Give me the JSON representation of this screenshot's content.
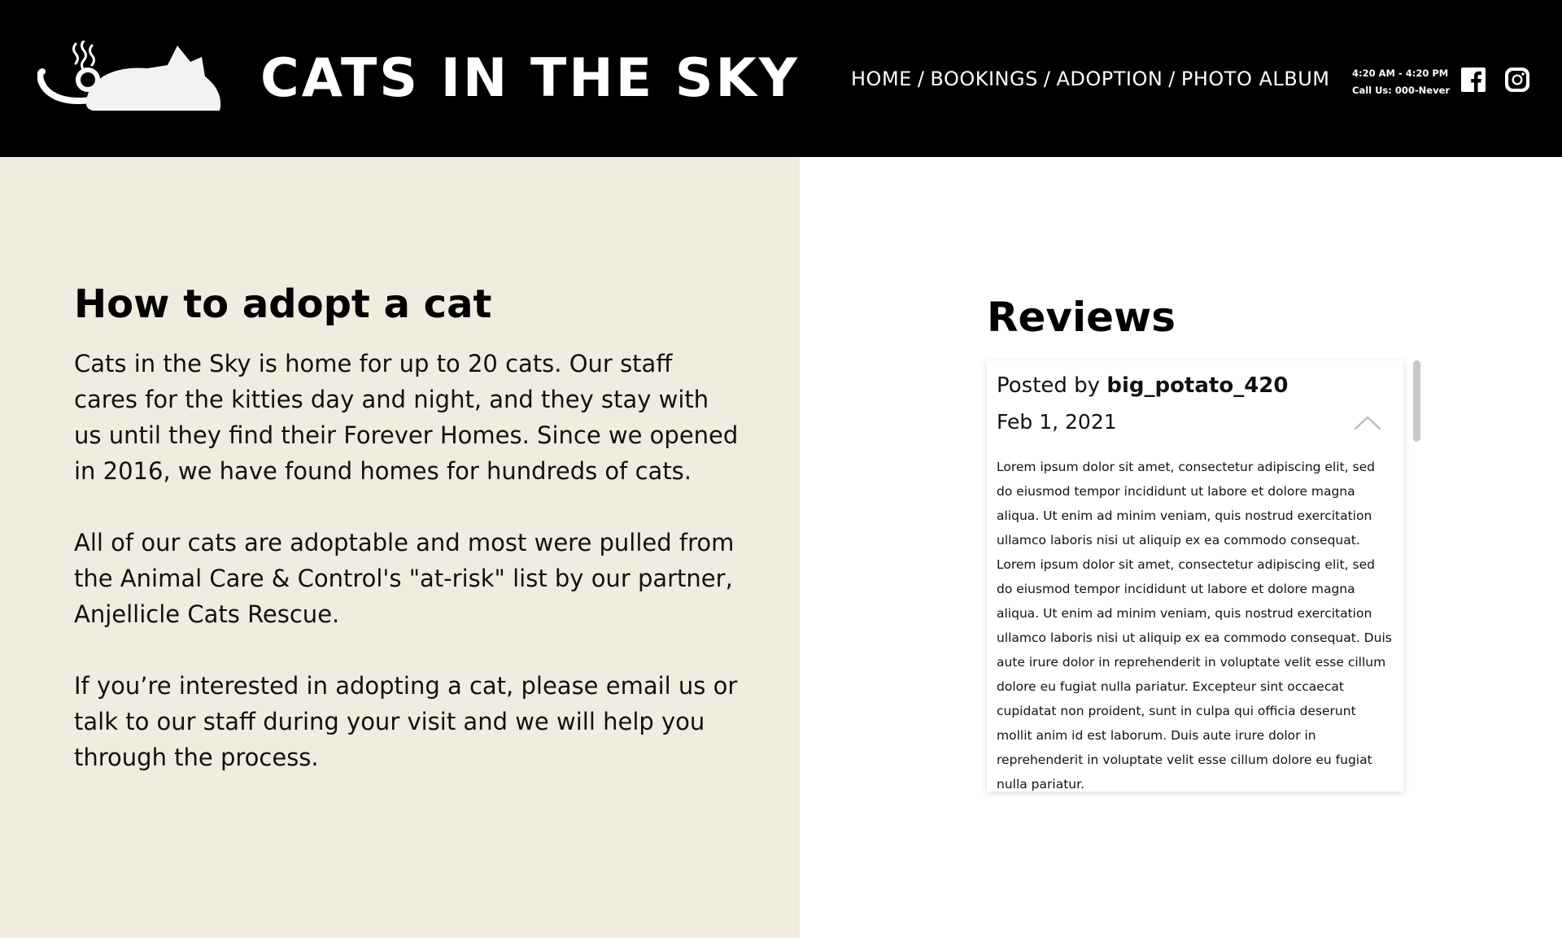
{
  "header": {
    "site_title": "CATS IN THE SKY",
    "nav": [
      {
        "label": "HOME"
      },
      {
        "label": "BOOKINGS"
      },
      {
        "label": "ADOPTION"
      },
      {
        "label": "PHOTO ALBUM"
      }
    ],
    "nav_separator": "/",
    "hours": "4:20 AM - 4:20 PM",
    "phone": "Call Us: 000-Never",
    "social": [
      "facebook-icon",
      "instagram-icon"
    ],
    "logo_icon": "cat-teapot-logo"
  },
  "adoption": {
    "title": "How to adopt a cat",
    "paragraphs": [
      "Cats in the Sky is home for up to 20 cats. Our staff cares for the kitties day and night, and they stay with us until they find  their Forever Homes.  Since we opened in 2016, we have found homes for hundreds of cats.",
      "All of our cats are adoptable and most were pulled from the Animal Care & Control's \"at-risk\" list by our partner, Anjellicle Cats Rescue.",
      "If you’re interested in adopting a cat, please email us or talk to our staff during your visit and we will help you through the process."
    ]
  },
  "reviews": {
    "title": "Reviews",
    "items": [
      {
        "posted_prefix": "Posted by ",
        "author": "big_potato_420",
        "date": "Feb 1, 2021",
        "text": "Lorem ipsum dolor sit amet, consectetur adipiscing elit, sed do eiusmod tempor incididunt ut labore et dolore magna aliqua. Ut enim ad minim veniam, quis nostrud exercitation ullamco laboris nisi ut aliquip ex ea commodo consequat. Lorem ipsum dolor sit amet, consectetur adipiscing elit, sed do eiusmod tempor incididunt ut labore et dolore magna aliqua. Ut enim ad minim veniam, quis nostrud exercitation ullamco laboris nisi ut aliquip ex ea commodo consequat. Duis aute irure dolor in reprehenderit in voluptate velit esse cillum dolore eu fugiat nulla pariatur. Excepteur sint occaecat cupidatat non proident, sunt in culpa qui officia deserunt mollit anim id est laborum. Duis aute irure dolor in reprehenderit in voluptate velit esse cillum dolore eu fugiat nulla pariatur.",
        "expand_icon": "chevron-up-icon"
      }
    ]
  },
  "colors": {
    "header_bg": "#000000",
    "left_panel_bg": "#f0ecdf",
    "text": "#111111",
    "scrollbar": "#c8c8c8"
  }
}
